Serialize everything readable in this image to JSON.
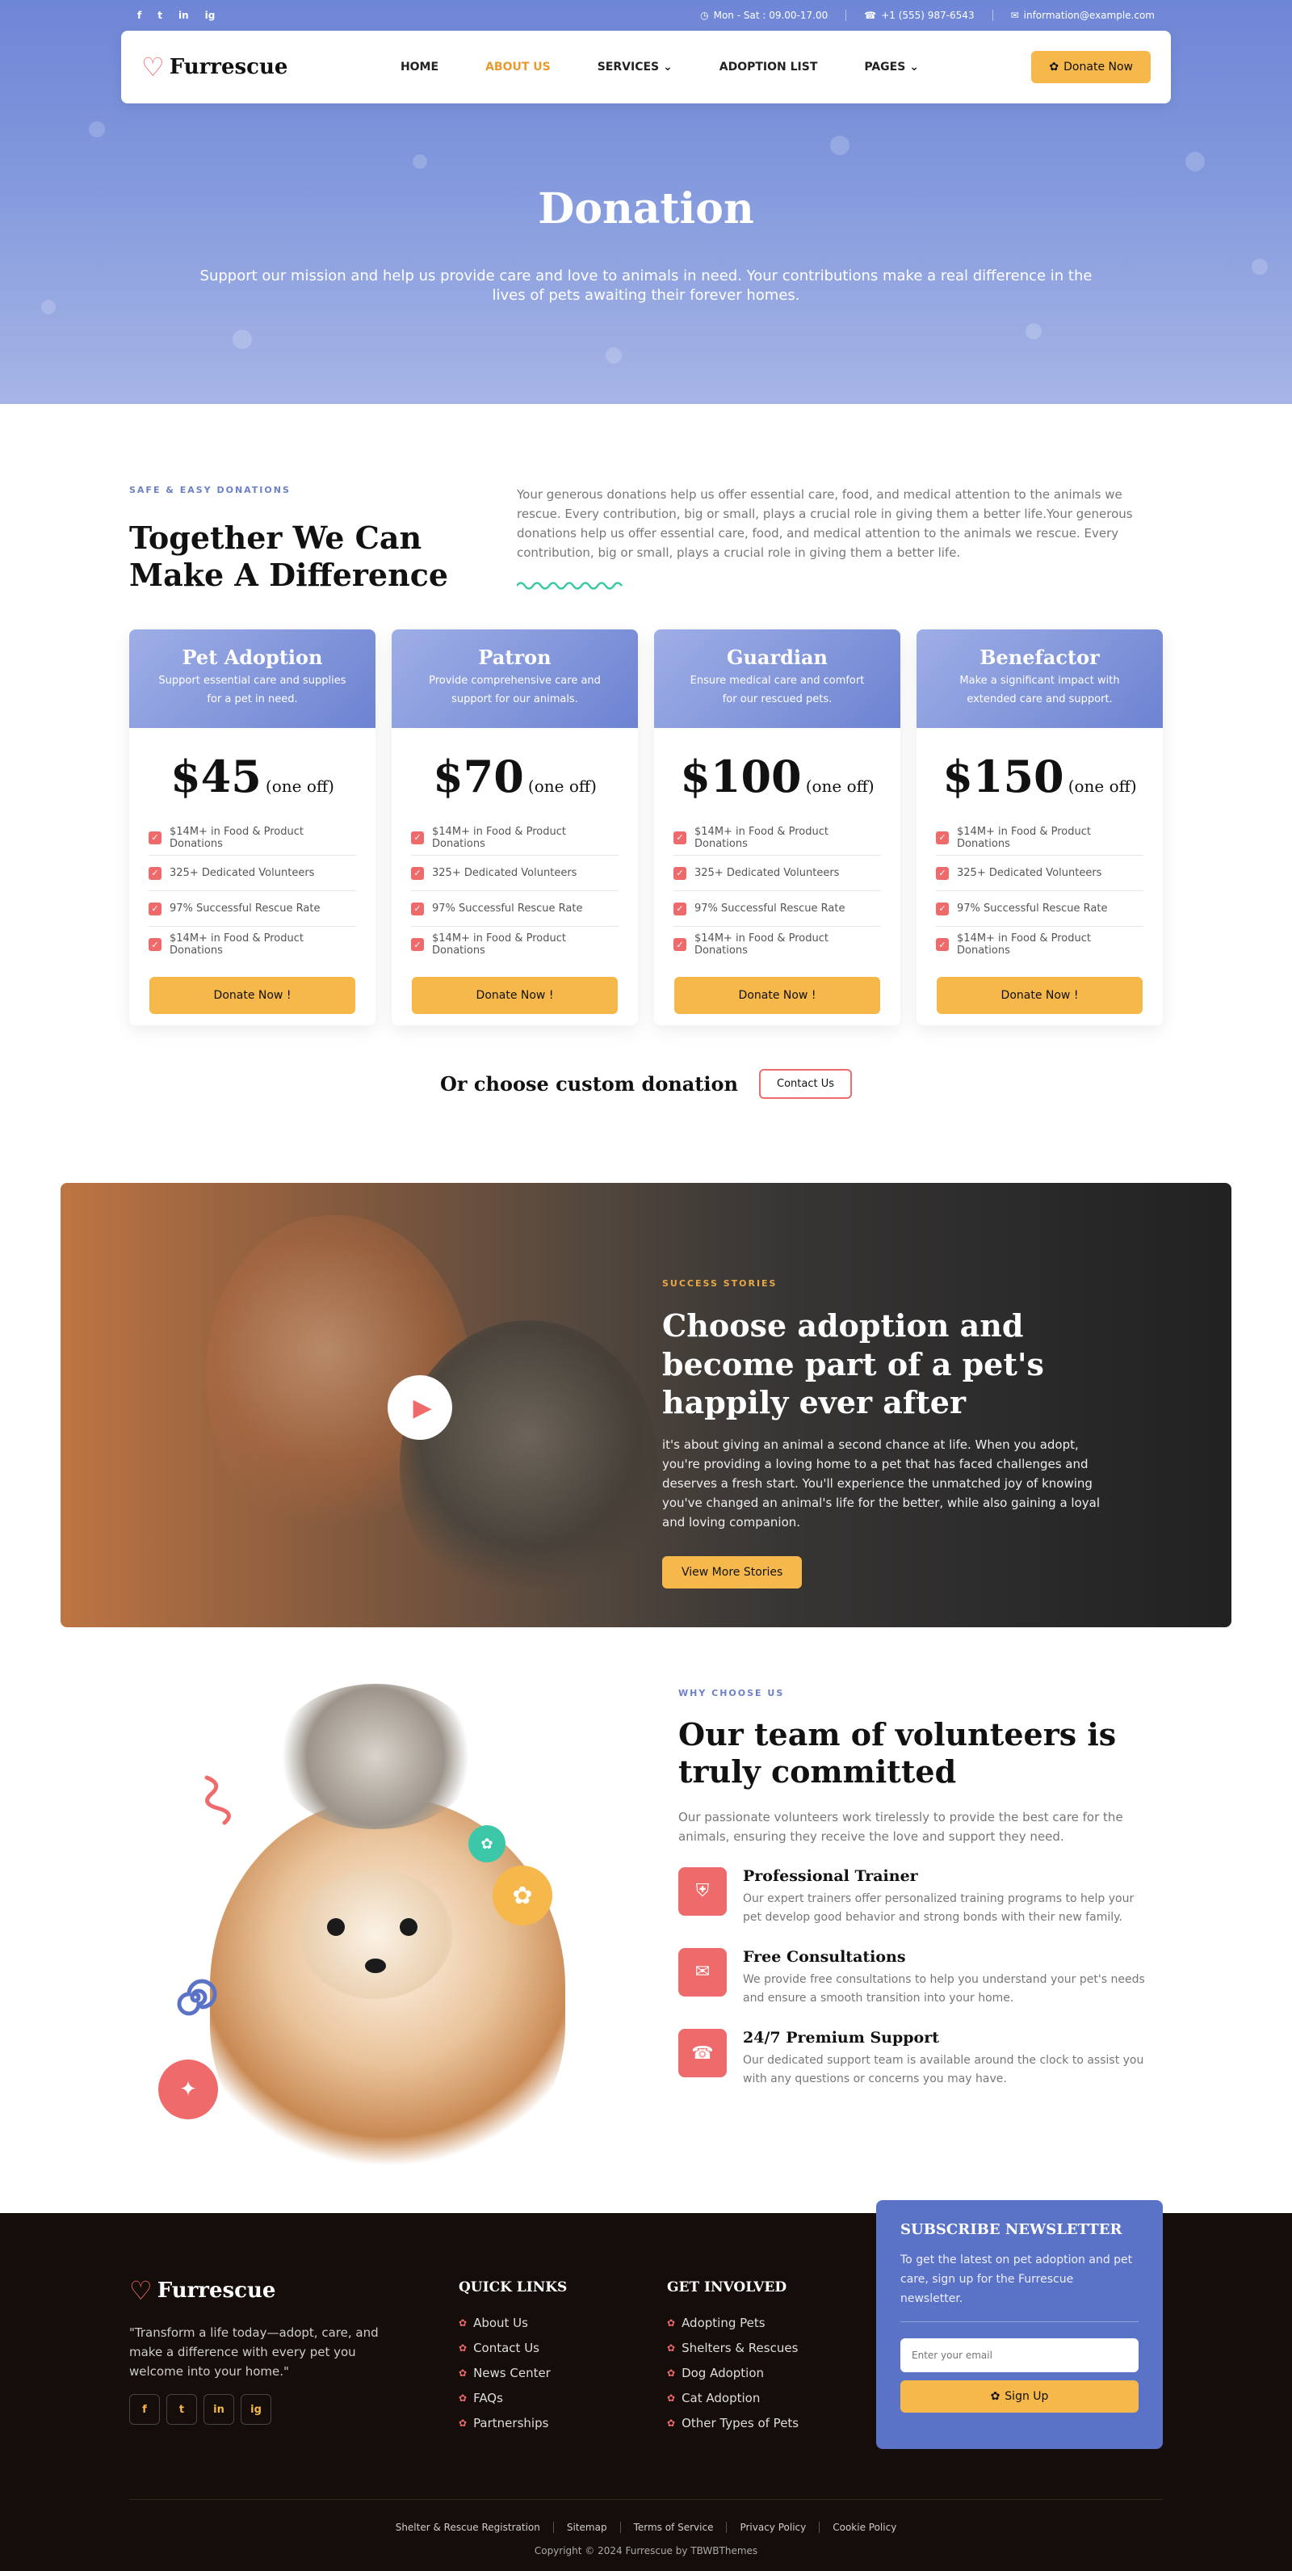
{
  "topbar": {
    "socials": [
      "f",
      "t",
      "in",
      "ig"
    ],
    "hours": "Mon - Sat : 09.00-17.00",
    "phone": "+1 (555) 987-6543",
    "email": "information@example.com"
  },
  "nav": {
    "brand": "Furrescue",
    "links": [
      "HOME",
      "ABOUT US",
      "SERVICES",
      "ADOPTION LIST",
      "PAGES"
    ],
    "active": "ABOUT US",
    "cta": "Donate Now"
  },
  "hero": {
    "title": "Donation",
    "subtitle": "Support our mission and help us provide care and love to animals in need. Your contributions make a real difference in the lives of pets awaiting their forever homes."
  },
  "intro": {
    "eyebrow": "SAFE & EASY DONATIONS",
    "title": "Together We Can Make A Difference",
    "body": "Your generous donations help us offer essential care, food, and medical attention to the animals we rescue. Every contribution, big or small, plays a crucial role in giving them a better life.Your generous donations help us offer essential care, food, and medical attention to the animals we rescue. Every contribution, big or small, plays a crucial role in giving them a better life."
  },
  "plans": [
    {
      "name": "Pet Adoption",
      "desc": "Support essential care and supplies for a pet in need.",
      "price": "$45",
      "unit": "(one off)"
    },
    {
      "name": "Patron",
      "desc": "Provide comprehensive care and support for our animals.",
      "price": "$70",
      "unit": "(one off)"
    },
    {
      "name": "Guardian",
      "desc": "Ensure medical care and comfort for our rescued pets.",
      "price": "$100",
      "unit": "(one off)"
    },
    {
      "name": "Benefactor",
      "desc": "Make a significant impact with extended care and support.",
      "price": "$150",
      "unit": "(one off)"
    }
  ],
  "plan_features": [
    "$14M+ in Food & Product Donations",
    "325+ Dedicated Volunteers",
    "97% Successful Rescue Rate",
    "$14M+ in Food & Product Donations"
  ],
  "plan_button": "Donate Now !",
  "custom": {
    "text": "Or choose custom donation",
    "button": "Contact Us"
  },
  "stories": {
    "eyebrow": "SUCCESS STORIES",
    "title": "Choose adoption and become part of a pet's happily ever after",
    "body": "it's about giving an animal a second chance at life. When you adopt, you're providing a loving home to a pet that has faced challenges and deserves a fresh start. You'll experience the unmatched joy of knowing you've changed an animal's life for the better, while also gaining a loyal and loving companion.",
    "button": "View More Stories"
  },
  "volunteers": {
    "eyebrow": "WHY CHOOSE US",
    "title": "Our team of volunteers is truly committed",
    "lead": "Our passionate volunteers work tirelessly to provide the best care for the animals, ensuring they receive the love and support they need.",
    "features": [
      {
        "title": "Professional Trainer",
        "desc": "Our expert trainers offer personalized training programs to help your pet develop good behavior and strong bonds with their new family."
      },
      {
        "title": "Free Consultations",
        "desc": "We provide free consultations to help you understand your pet's needs and ensure a smooth transition into your home."
      },
      {
        "title": "24/7 Premium Support",
        "desc": "Our dedicated support team is available around the clock to assist you with any questions or concerns you may have."
      }
    ]
  },
  "footer": {
    "brand": "Furrescue",
    "quote": "\"Transform a life today—adopt, care, and make a difference with every pet you welcome into your home.\"",
    "socials": [
      "f",
      "t",
      "in",
      "ig"
    ],
    "quick_title": "QUICK LINKS",
    "quick_links": [
      "About Us",
      "Contact Us",
      "News Center",
      "FAQs",
      "Partnerships"
    ],
    "involved_title": "GET INVOLVED",
    "involved_links": [
      "Adopting Pets",
      "Shelters & Rescues",
      "Dog Adoption",
      "Cat Adoption",
      "Other Types of Pets"
    ],
    "newsletter_title": "SUBSCRIBE NEWSLETTER",
    "newsletter_text": "To get the latest on pet adoption and pet care, sign up for the Furrescue newsletter.",
    "newsletter_placeholder": "Enter your email",
    "newsletter_button": "Sign Up",
    "bottom_links": [
      "Shelter & Rescue Registration",
      "Sitemap",
      "Terms of Service",
      "Privacy Policy",
      "Cookie Policy"
    ],
    "copyright": "Copyright © 2024 Furrescue by TBWBThemes"
  },
  "colors": {
    "accent": "#f6b84a",
    "primary": "#6d83d2",
    "coral": "#ef6a6a",
    "footer_bg": "#150d09"
  }
}
